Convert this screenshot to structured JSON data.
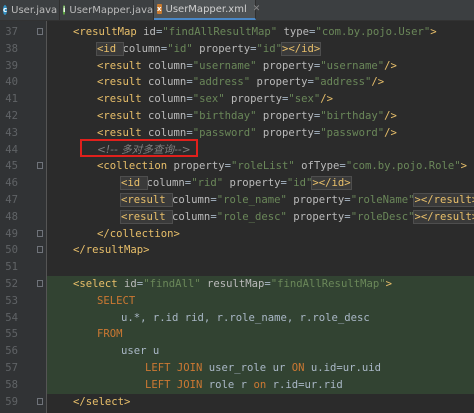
{
  "tabs": [
    {
      "label": "User.java",
      "icon": "java-class-icon",
      "active": false
    },
    {
      "label": "UserMapper.java",
      "icon": "java-interface-icon",
      "active": false
    },
    {
      "label": "UserMapper.xml",
      "icon": "xml-file-icon",
      "active": true
    }
  ],
  "colors": {
    "tag": "#e8bf6a",
    "attribute": "#bababa",
    "value": "#6a8759",
    "keyword": "#cc7832",
    "comment": "#808080",
    "sql_background": "#324332",
    "highlight_box": "#e0201c"
  },
  "lines": [
    {
      "n": "37",
      "t": [
        "<resultMap ",
        "id",
        "=",
        "\"findAllResultMap\"",
        " ",
        "type",
        "=",
        "\"com.by.pojo.User\"",
        ">"
      ]
    },
    {
      "n": "38",
      "t": [
        "<id ",
        "column",
        "=",
        "\"id\"",
        " ",
        "property",
        "=",
        "\"id\"",
        "></id>"
      ]
    },
    {
      "n": "39",
      "t": [
        "<result ",
        "column",
        "=",
        "\"username\"",
        " ",
        "property",
        "=",
        "\"username\"",
        "/>"
      ]
    },
    {
      "n": "40",
      "t": [
        "<result ",
        "column",
        "=",
        "\"address\"",
        " ",
        "property",
        "=",
        "\"address\"",
        "/>"
      ]
    },
    {
      "n": "41",
      "t": [
        "<result ",
        "column",
        "=",
        "\"sex\"",
        " ",
        "property",
        "=",
        "\"sex\"",
        "/>"
      ]
    },
    {
      "n": "42",
      "t": [
        "<result ",
        "column",
        "=",
        "\"birthday\"",
        " ",
        "property",
        "=",
        "\"birthday\"",
        "/>"
      ]
    },
    {
      "n": "43",
      "t": [
        "<result ",
        "column",
        "=",
        "\"password\"",
        " ",
        "property",
        "=",
        "\"password\"",
        "/>"
      ]
    },
    {
      "n": "44",
      "t": [
        "<!-- 多对多查询-->"
      ]
    },
    {
      "n": "45",
      "t": [
        "<collection ",
        "property",
        "=",
        "\"roleList\"",
        " ",
        "ofType",
        "=",
        "\"com.by.pojo.Role\"",
        ">"
      ]
    },
    {
      "n": "46",
      "t": [
        "<id ",
        "column",
        "=",
        "\"rid\"",
        " ",
        "property",
        "=",
        "\"id\"",
        "></id>"
      ]
    },
    {
      "n": "47",
      "t": [
        "<result ",
        "column",
        "=",
        "\"role_name\"",
        " ",
        "property",
        "=",
        "\"roleName\"",
        "></result>"
      ]
    },
    {
      "n": "48",
      "t": [
        "<result ",
        "column",
        "=",
        "\"role_desc\"",
        " ",
        "property",
        "=",
        "\"roleDesc\"",
        "></result>"
      ]
    },
    {
      "n": "49",
      "t": [
        "</collection>"
      ]
    },
    {
      "n": "50",
      "t": [
        "</resultMap>"
      ]
    },
    {
      "n": "51",
      "t": [
        ""
      ]
    },
    {
      "n": "52",
      "t": [
        "<select ",
        "id",
        "=",
        "\"findAll\"",
        " ",
        "resultMap",
        "=",
        "\"findAllResultMap\"",
        ">"
      ]
    },
    {
      "n": "53",
      "t": [
        "SELECT"
      ]
    },
    {
      "n": "54",
      "t": [
        "u.*, r.id rid, r.role_name, r.role_desc"
      ]
    },
    {
      "n": "55",
      "t": [
        "FROM"
      ]
    },
    {
      "n": "56",
      "t": [
        "user u"
      ]
    },
    {
      "n": "57",
      "t": [
        "LEFT JOIN",
        " user_role ur ",
        "ON",
        " u.id=ur.uid"
      ]
    },
    {
      "n": "58",
      "t": [
        "LEFT JOIN",
        " role r ",
        "on",
        " r.id=ur.rid"
      ]
    },
    {
      "n": "59",
      "t": [
        "</select>"
      ]
    }
  ]
}
